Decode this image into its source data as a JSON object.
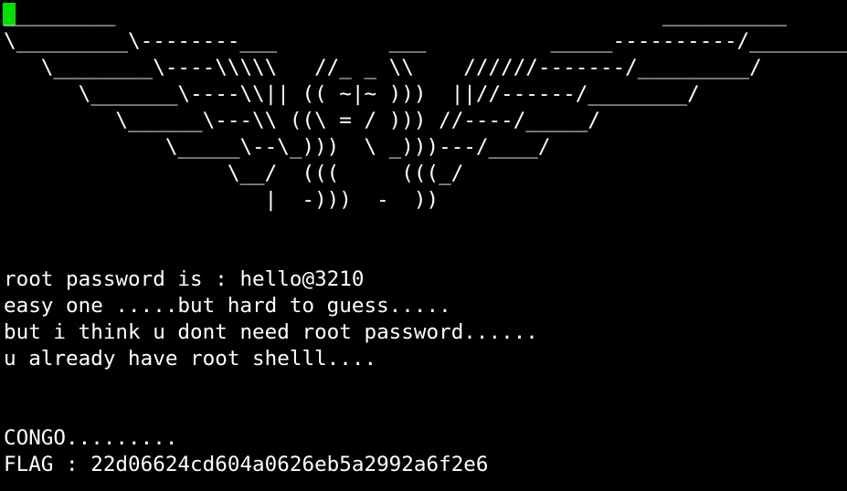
{
  "terminal": {
    "cursor_color": "#00e000",
    "background_color": "#000000",
    "text_color": "#ffffff",
    "art": [
      "_________                                            __________",
      "\\_________\\--------___         ___          _____----------/__________/",
      "   \\________\\----\\\\\\\\\\   //_ _ \\\\    //////-------/_________/",
      "      \\_______\\----\\\\|| (( ~|~ )))  ||//------/________/",
      "         \\______\\---\\\\ ((\\ = / ))) //----/_____/",
      "             \\_____\\--\\_)))  \\ _)))---/____/",
      "                  \\__/  (((     (((_/",
      "                     |  -)))  -  ))"
    ],
    "messages": [
      "root password is : hello@3210",
      "easy one .....but hard to guess.....",
      "but i think u dont need root password......",
      "u already have root shelll...."
    ],
    "congo": "CONGO.........",
    "flag": "FLAG : 22d06624cd604a0626eb5a2992a6f2e6"
  }
}
